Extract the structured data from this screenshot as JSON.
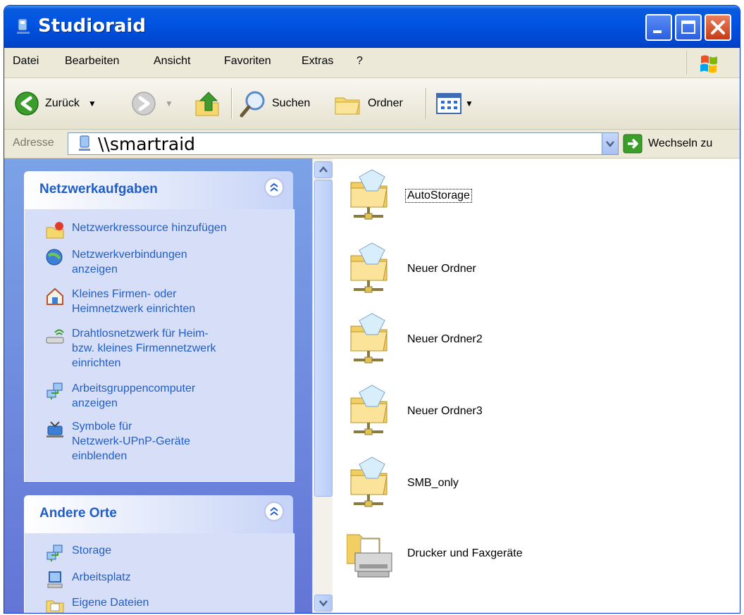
{
  "window": {
    "title": "Studioraid"
  },
  "menu": [
    "Datei",
    "Bearbeiten",
    "Ansicht",
    "Favoriten",
    "Extras",
    "?"
  ],
  "toolbar": {
    "back_label": "Zurück",
    "search_label": "Suchen",
    "folders_label": "Ordner"
  },
  "address": {
    "label": "Adresse",
    "value": "\\\\smartraid",
    "go_label": "Wechseln zu"
  },
  "network_tasks": {
    "title": "Netzwerkaufgaben",
    "items": [
      {
        "label": "Netzwerkressource hinzufügen",
        "icon": "add-network-place-icon"
      },
      {
        "label": "Netzwerkverbindungen\nanzeigen",
        "icon": "network-connections-icon"
      },
      {
        "label": "Kleines Firmen- oder\nHeimnetzwerk einrichten",
        "icon": "home-network-setup-icon"
      },
      {
        "label": "Drahtlosnetzwerk für Heim-\nbzw. kleines Firmennetzwerk\neinrichten",
        "icon": "wireless-network-icon"
      },
      {
        "label": "Arbeitsgruppencomputer\nanzeigen",
        "icon": "workgroup-computers-icon"
      },
      {
        "label": "Symbole für\nNetzwerk-UPnP-Geräte\neinblenden",
        "icon": "upnp-devices-icon"
      }
    ]
  },
  "other_places": {
    "title": "Andere Orte",
    "items": [
      {
        "label": "Storage",
        "icon": "network-workgroup-icon"
      },
      {
        "label": "Arbeitsplatz",
        "icon": "my-computer-icon"
      },
      {
        "label": "Eigene Dateien",
        "icon": "my-documents-icon"
      }
    ]
  },
  "shares": [
    {
      "label": "AutoStorage",
      "icon": "shared-folder-icon",
      "selected": true
    },
    {
      "label": "Neuer Ordner",
      "icon": "shared-folder-icon"
    },
    {
      "label": "Neuer Ordner2",
      "icon": "shared-folder-icon"
    },
    {
      "label": "Neuer Ordner3",
      "icon": "shared-folder-icon"
    },
    {
      "label": "SMB_only",
      "icon": "shared-folder-icon"
    },
    {
      "label": "Drucker und Faxgeräte",
      "icon": "printers-faxes-icon"
    }
  ],
  "colors": {
    "titlebar": "#0054e3",
    "task_link": "#215dc6",
    "pane_bg": "#7ba2e7"
  }
}
